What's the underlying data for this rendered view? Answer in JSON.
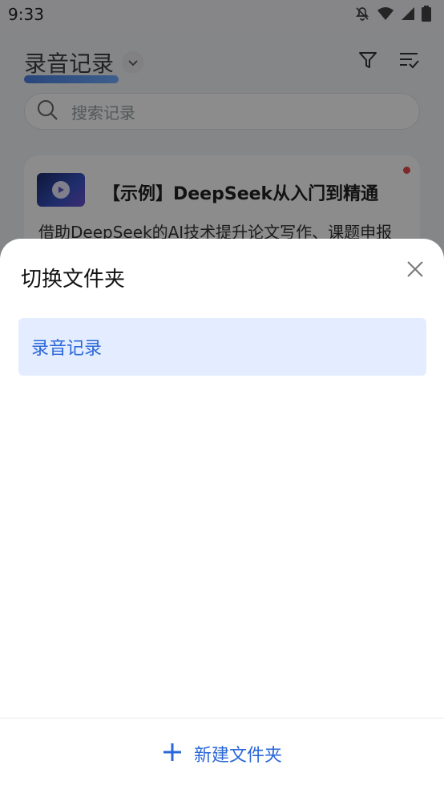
{
  "status_bar": {
    "time": "9:33",
    "icons": [
      "bell-off-icon",
      "wifi-icon",
      "signal-icon",
      "battery-icon"
    ]
  },
  "header": {
    "title": "录音记录",
    "actions": [
      "filter-icon",
      "sort-list-icon"
    ]
  },
  "search": {
    "placeholder": "搜索记录"
  },
  "card": {
    "title": "【示例】DeepSeek从入门到精通",
    "description": "借助DeepSeek的AI技术提升论文写作、课题申报",
    "unread": true
  },
  "sheet": {
    "title": "切换文件夹",
    "folders": [
      {
        "label": "录音记录",
        "selected": true
      }
    ],
    "new_folder_label": "新建文件夹"
  },
  "colors": {
    "accent": "#2a67d8",
    "selected_bg": "#e4edff",
    "overlay": "rgba(0,0,0,0.45)"
  }
}
